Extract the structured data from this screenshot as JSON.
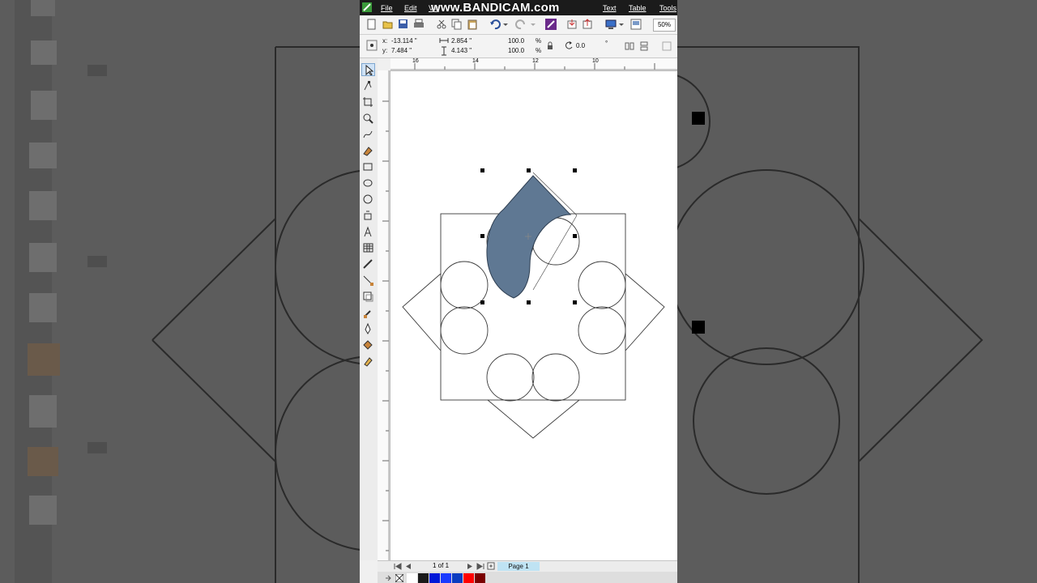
{
  "watermark": "www.BANDICAM.com",
  "menu": {
    "file": "File",
    "edit": "Edit",
    "view": "Vie",
    "text": "Text",
    "table": "Table",
    "tools": "Tools"
  },
  "toolbar": {
    "zoom": "50%"
  },
  "properties": {
    "x_value": "-13.114 \"",
    "y_value": "7.484 \"",
    "width_value": "2.854 \"",
    "height_value": "4.143 \"",
    "scale_w": "100.0",
    "scale_h": "100.0",
    "percent_w": "%",
    "percent_h": "%",
    "rotation": "0.0",
    "degree": "°",
    "x_label": "x:",
    "y_label": "y:"
  },
  "ruler": {
    "h_labels": [
      "16",
      "14",
      "12",
      "10"
    ]
  },
  "status": {
    "page_count": "1 of 1",
    "page_tab": "Page 1"
  },
  "colors": {
    "selected_fill": "#5f7893",
    "accent": "#bfe3f3",
    "menubar": "#1b1b1b"
  },
  "palette": [
    "#ffffff",
    "#1a1a1a",
    "#0018d8",
    "#1a3aff",
    "#0b3cc0",
    "#ff0000",
    "#7a0000"
  ]
}
